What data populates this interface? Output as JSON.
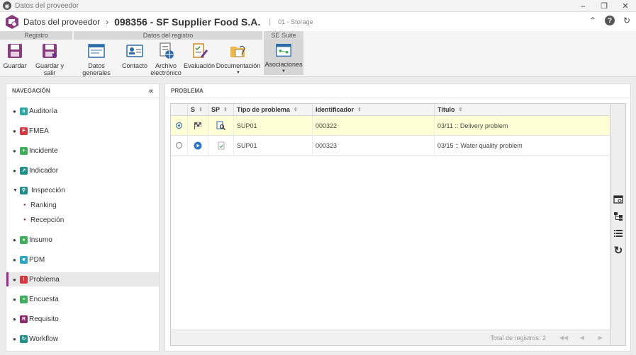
{
  "window": {
    "title": "Datos del proveedor",
    "controls": [
      "minimize",
      "restore",
      "close"
    ]
  },
  "header": {
    "title": "Datos del proveedor",
    "record": "098356 - SF Supplier Food S.A.",
    "subtitle": "01 - Storage",
    "actions": [
      "collapse-up-icon",
      "help-icon",
      "refresh-icon"
    ]
  },
  "ribbon": {
    "groups": [
      {
        "label": "Registro"
      },
      {
        "label": "Datos del registro"
      },
      {
        "label": "SE Suite"
      }
    ],
    "buttons": {
      "guardar": "Guardar",
      "guardar_salir": "Guardar y salir",
      "datos_generales": "Datos generales",
      "contacto": "Contacto",
      "archivo": "Archivo electrónico",
      "evaluacion": "Evaluación",
      "documentacion": "Documentación",
      "asociaciones": "Asociaciones"
    }
  },
  "nav": {
    "title": "NAVEGACIÓN",
    "items": [
      {
        "label": "Auditoría",
        "color": "#2aa7a0"
      },
      {
        "label": "FMEA",
        "color": "#d9363e"
      },
      {
        "label": "Incidente",
        "color": "#3fae5a"
      },
      {
        "label": "Indicador",
        "color": "#1f8f8a"
      },
      {
        "label": "Inspección",
        "color": "#1f8f8a"
      },
      {
        "label": "Ranking"
      },
      {
        "label": "Recepción"
      },
      {
        "label": "Insumo",
        "color": "#3fae5a"
      },
      {
        "label": "PDM",
        "color": "#2aa7c4"
      },
      {
        "label": "Problema",
        "color": "#d9363e"
      },
      {
        "label": "Encuesta",
        "color": "#3fae5a"
      },
      {
        "label": "Requisito",
        "color": "#8b2a6e"
      },
      {
        "label": "Workflow",
        "color": "#1f8f8a"
      }
    ]
  },
  "main": {
    "title": "PROBLEMA",
    "columns": [
      "S",
      "SP",
      "Tipo de problema",
      "Identificador",
      "Título"
    ],
    "rows": [
      {
        "tipo": "SUP01",
        "id": "000322",
        "titulo": "03/11 :: Delivery problem",
        "selected": true
      },
      {
        "tipo": "SUP01",
        "id": "000323",
        "titulo": "03/15 :: Water quality problem",
        "selected": false
      }
    ],
    "footer": "Total de registros: 2"
  },
  "colors": {
    "accent": "#9b2b8f",
    "selected_row": "#ffffd6"
  }
}
